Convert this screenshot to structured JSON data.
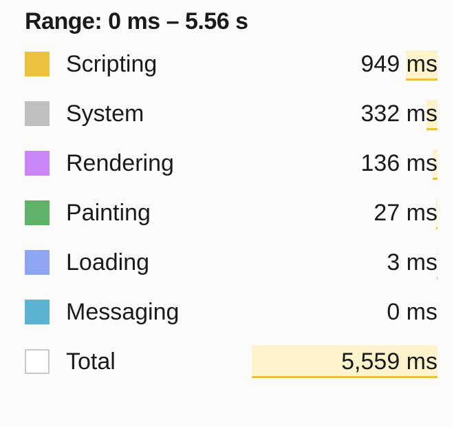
{
  "header": {
    "range_label": "Range: 0 ms – 5.56 s"
  },
  "categories": [
    {
      "key": "scripting",
      "label": "Scripting",
      "value": "949 ms",
      "color": "#eac23f"
    },
    {
      "key": "system",
      "label": "System",
      "value": "332 ms",
      "color": "#bfbfbf"
    },
    {
      "key": "rendering",
      "label": "Rendering",
      "value": "136 ms",
      "color": "#c986f5"
    },
    {
      "key": "painting",
      "label": "Painting",
      "value": "27 ms",
      "color": "#5fb267"
    },
    {
      "key": "loading",
      "label": "Loading",
      "value": "3 ms",
      "color": "#8ea6f2"
    },
    {
      "key": "messaging",
      "label": "Messaging",
      "value": "0 ms",
      "color": "#5cb3d1"
    }
  ],
  "total": {
    "label": "Total",
    "value": "5,559 ms"
  },
  "chart_data": {
    "type": "table",
    "title": "Range: 0 ms – 5.56 s",
    "unit": "ms",
    "categories": [
      "Scripting",
      "System",
      "Rendering",
      "Painting",
      "Loading",
      "Messaging"
    ],
    "values": [
      949,
      332,
      136,
      27,
      3,
      0
    ],
    "total": 5559,
    "range": {
      "start_ms": 0,
      "end_s": 5.56
    }
  }
}
